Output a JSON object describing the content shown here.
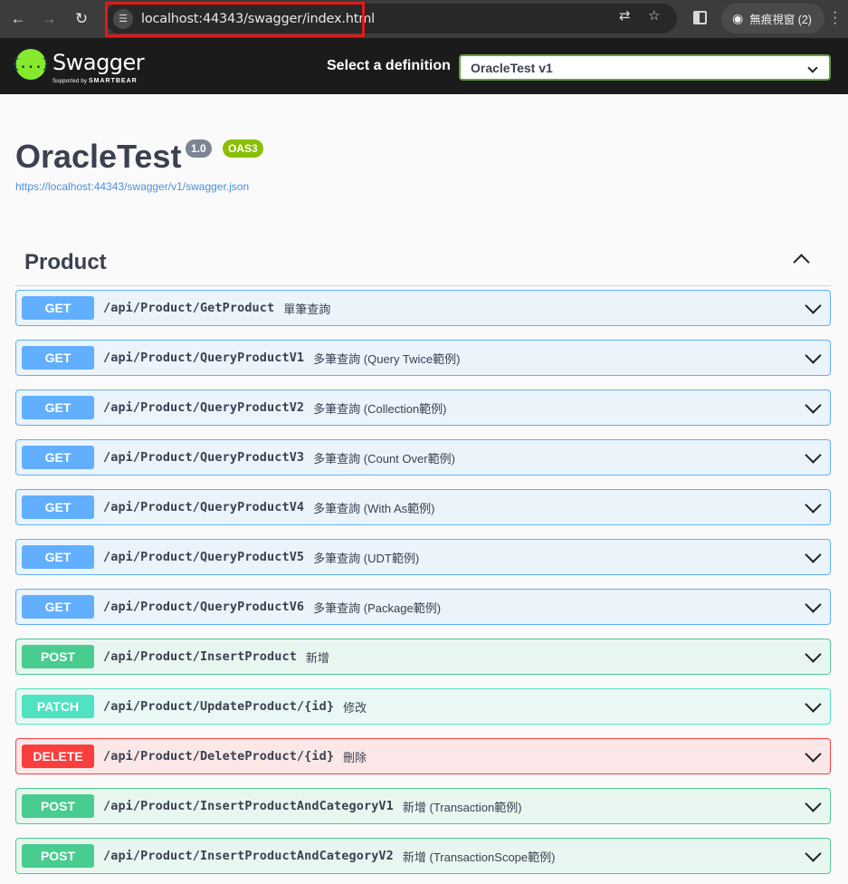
{
  "browser": {
    "url": "localhost:44343/swagger/index.html",
    "incognito_label": "無痕視窗 (2)"
  },
  "topbar": {
    "logo_text": "Swagger",
    "logo_sub_prefix": "Supported by",
    "logo_sub_brand": "SMARTBEAR",
    "definition_label": "Select a definition",
    "definition_selected": "OracleTest v1"
  },
  "info": {
    "title": "OracleTest",
    "version": "1.0",
    "oas": "OAS3",
    "spec_url": "https://localhost:44343/swagger/v1/swagger.json"
  },
  "tag": {
    "name": "Product",
    "operations": [
      {
        "method": "GET",
        "path": "/api/Product/GetProduct",
        "summary": "單筆查詢"
      },
      {
        "method": "GET",
        "path": "/api/Product/QueryProductV1",
        "summary": "多筆查詢 (Query Twice範例)"
      },
      {
        "method": "GET",
        "path": "/api/Product/QueryProductV2",
        "summary": "多筆查詢 (Collection範例)"
      },
      {
        "method": "GET",
        "path": "/api/Product/QueryProductV3",
        "summary": "多筆查詢 (Count Over範例)"
      },
      {
        "method": "GET",
        "path": "/api/Product/QueryProductV4",
        "summary": "多筆查詢 (With As範例)"
      },
      {
        "method": "GET",
        "path": "/api/Product/QueryProductV5",
        "summary": "多筆查詢 (UDT範例)"
      },
      {
        "method": "GET",
        "path": "/api/Product/QueryProductV6",
        "summary": "多筆查詢 (Package範例)"
      },
      {
        "method": "POST",
        "path": "/api/Product/InsertProduct",
        "summary": "新增"
      },
      {
        "method": "PATCH",
        "path": "/api/Product/UpdateProduct/{id}",
        "summary": "修改"
      },
      {
        "method": "DELETE",
        "path": "/api/Product/DeleteProduct/{id}",
        "summary": "刪除"
      },
      {
        "method": "POST",
        "path": "/api/Product/InsertProductAndCategoryV1",
        "summary": "新增 (Transaction範例)"
      },
      {
        "method": "POST",
        "path": "/api/Product/InsertProductAndCategoryV2",
        "summary": "新增 (TransactionScope範例)"
      }
    ]
  }
}
